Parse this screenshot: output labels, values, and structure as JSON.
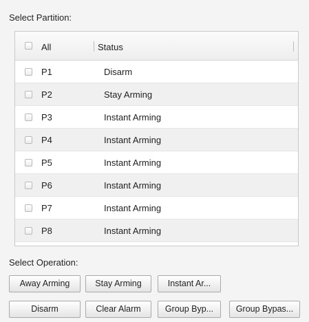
{
  "select_partition": {
    "label": "Select Partition:",
    "header": {
      "all_label": "All",
      "status_label": "Status"
    },
    "rows": [
      {
        "name": "P1",
        "status": "Disarm"
      },
      {
        "name": "P2",
        "status": "Stay Arming"
      },
      {
        "name": "P3",
        "status": "Instant Arming"
      },
      {
        "name": "P4",
        "status": "Instant Arming"
      },
      {
        "name": "P5",
        "status": "Instant Arming"
      },
      {
        "name": "P6",
        "status": "Instant Arming"
      },
      {
        "name": "P7",
        "status": "Instant Arming"
      },
      {
        "name": "P8",
        "status": "Instant Arming"
      }
    ]
  },
  "select_operation": {
    "label": "Select Operation:",
    "buttons": {
      "away_arming": "Away Arming",
      "stay_arming": "Stay Arming",
      "instant_arming": "Instant Ar...",
      "disarm": "Disarm",
      "clear_alarm": "Clear Alarm",
      "group_bypass": "Group Byp...",
      "group_bypass_recover": "Group Bypas..."
    }
  }
}
